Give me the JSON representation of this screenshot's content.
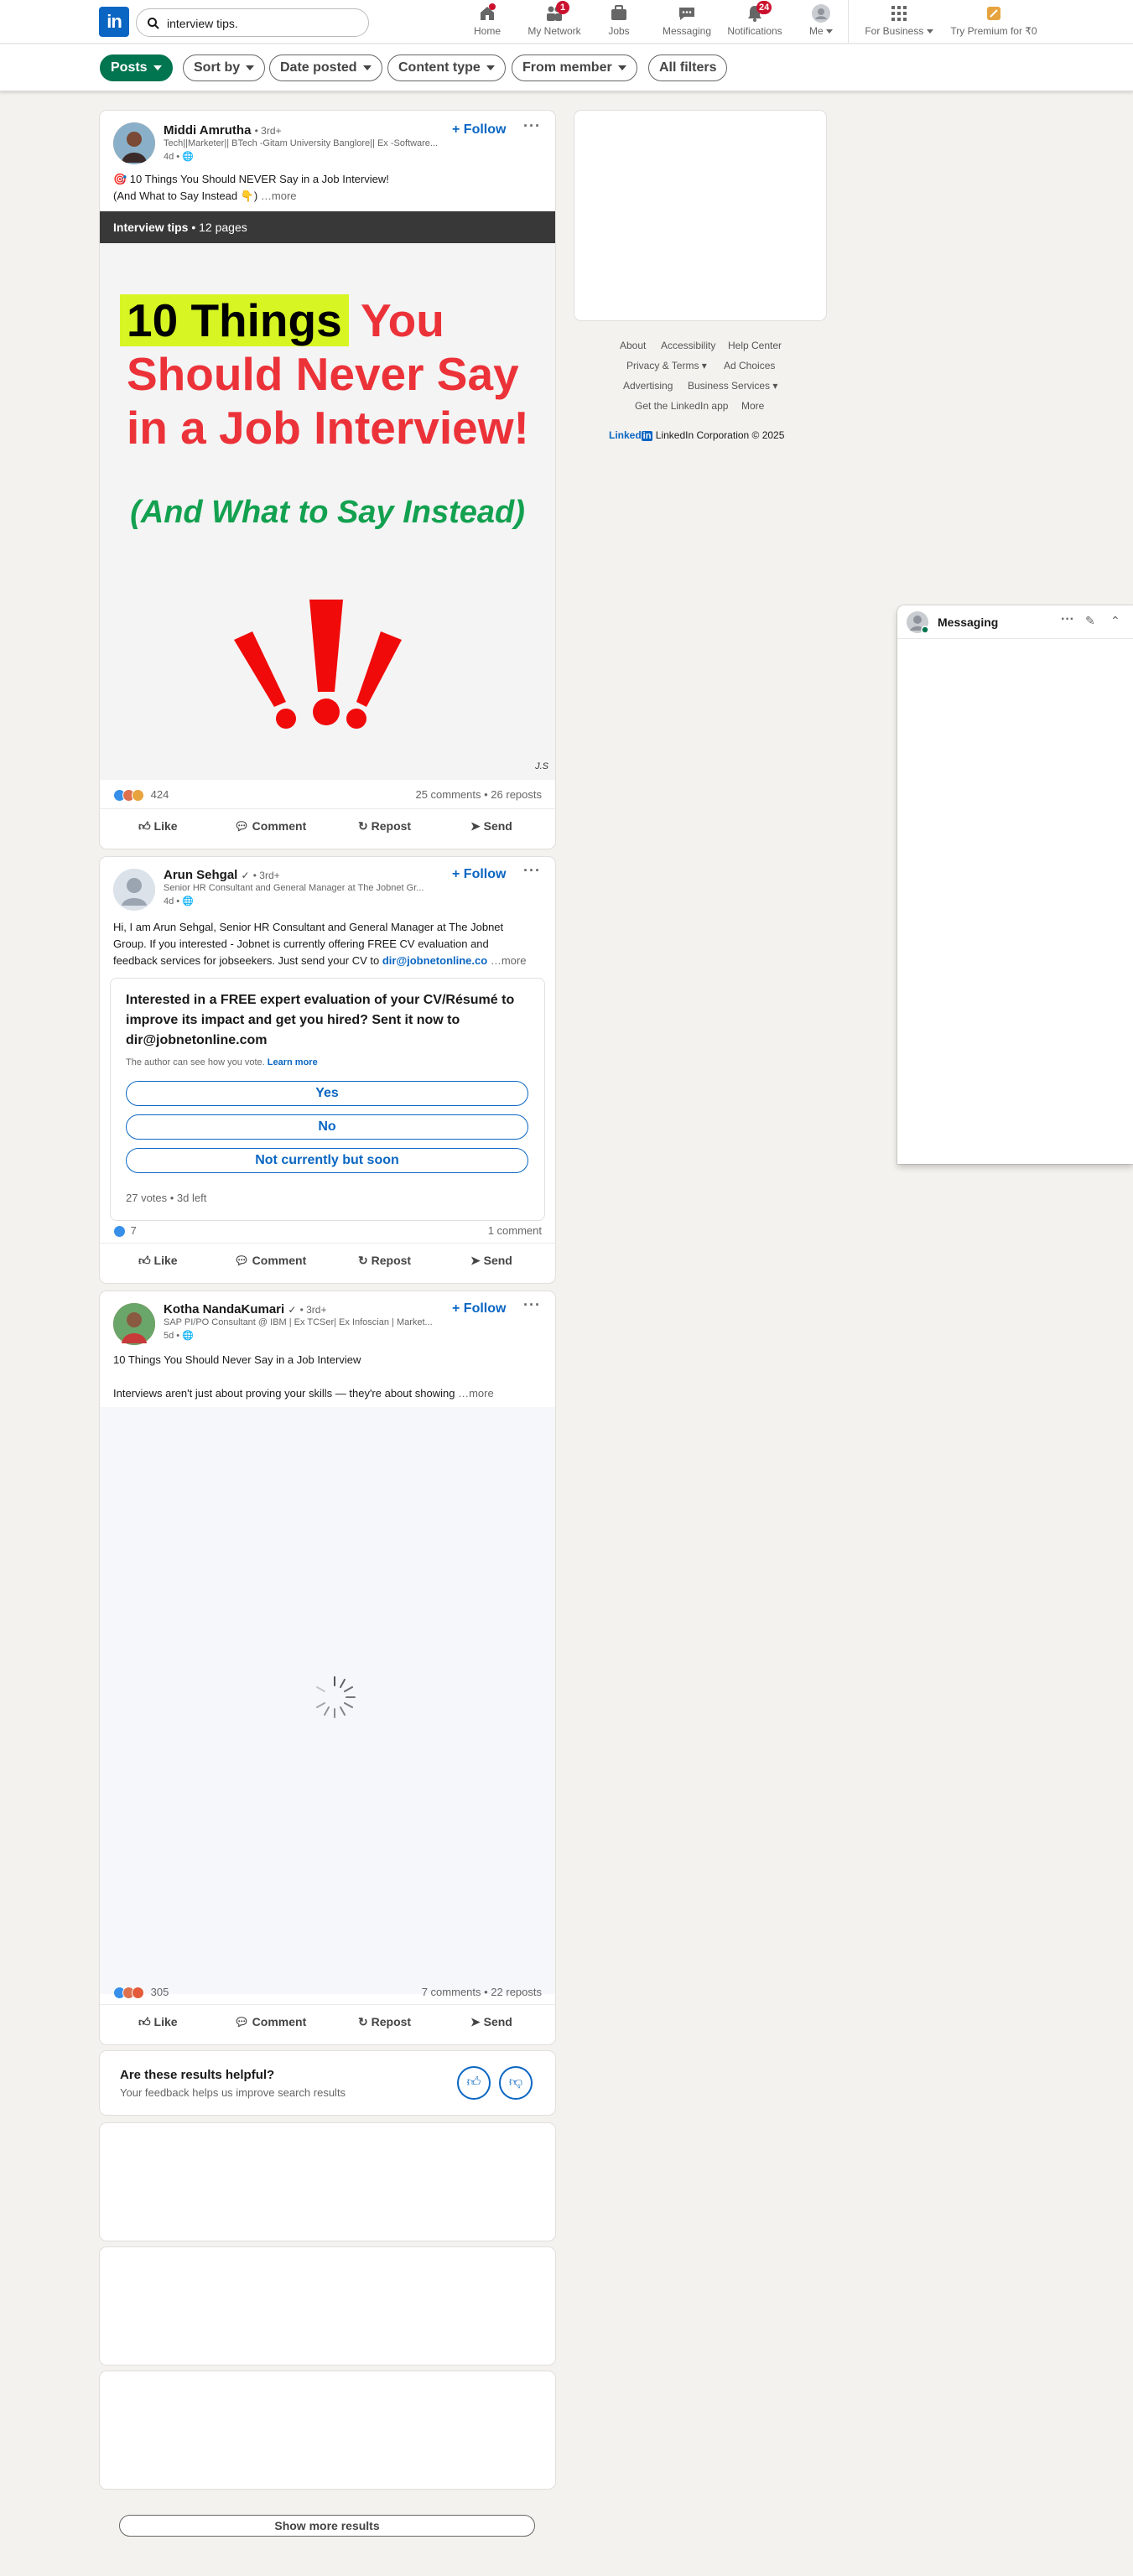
{
  "nav": {
    "logo_text": "in",
    "search_value": "interview tips.",
    "items": [
      {
        "label": "Home",
        "badge": "",
        "icon": "home-icon"
      },
      {
        "label": "My Network",
        "badge": "1",
        "icon": "network-icon"
      },
      {
        "label": "Jobs",
        "badge": "",
        "icon": "jobs-icon"
      },
      {
        "label": "Messaging",
        "badge": "",
        "icon": "messaging-icon"
      },
      {
        "label": "Notifications",
        "badge": "24",
        "icon": "bell-icon"
      },
      {
        "label": "Me",
        "badge": "",
        "icon": "avatar-icon"
      },
      {
        "label": "For Business",
        "badge": "",
        "icon": "grid-icon"
      },
      {
        "label": "Try Premium for ₹0",
        "badge": "",
        "icon": "premium-icon"
      }
    ]
  },
  "filters": {
    "posts": "Posts",
    "sort_by": "Sort by",
    "date_posted": "Date posted",
    "content_type": "Content type",
    "from_member": "From member",
    "all_filters": "All filters"
  },
  "posts": [
    {
      "author": "Middi Amrutha",
      "degree": "• 3rd+",
      "subtitle": "Tech||Marketer|| BTech -Gitam University Banglore|| Ex -Software...",
      "time": "4d •",
      "follow": "+ Follow",
      "text_line1": "🎯 10 Things You Should NEVER Say in a Job Interview!",
      "text_line2": "(And What to Say Instead 👇)",
      "more": "…more",
      "doc_title": "Interview tips",
      "doc_pages": " • 12 pages",
      "doc_heading_hl": "10 Things",
      "doc_heading_1": " You",
      "doc_heading_2": "Should Never Say",
      "doc_heading_3": "in a Job Interview!",
      "doc_sub": "(And What to Say Instead)",
      "doc_sig": "J.S",
      "reactions": "424",
      "stats": "25 comments • 26 reposts"
    },
    {
      "author": "Arun Sehgal",
      "degree": "• 3rd+",
      "subtitle": "Senior HR Consultant and General Manager at The Jobnet Gr...",
      "time": "4d •",
      "follow": "+ Follow",
      "text_line1": "Hi, I am Arun Sehgal, Senior HR Consultant and General Manager at The Jobnet",
      "text_line2": "Group. If you interested - Jobnet is currently offering FREE CV evaluation and",
      "text_line3": "feedback services for jobseekers. Just send your CV to",
      "email": "dir@jobnetonline.co",
      "more": "…more",
      "poll_question": "Interested in a FREE expert evaluation of your CV/Résumé to improve its impact and get you hired? Sent it now to dir@jobnetonline.com",
      "poll_note": "The author can see how you vote.",
      "poll_learn": "Learn more",
      "poll_options": [
        "Yes",
        "No",
        "Not currently but soon"
      ],
      "poll_meta": "27 votes • 3d left",
      "reactions": "7",
      "stats": "1 comment"
    },
    {
      "author": "Kotha NandaKumari",
      "degree": "• 3rd+",
      "subtitle": "SAP PI/PO Consultant @ IBM | Ex TCSer| Ex Infoscian | Market...",
      "time": "5d •",
      "follow": "+ Follow",
      "text_line1": "10 Things You Should Never Say in a Job Interview",
      "text_line2": "Interviews aren't just about proving your skills — they're about showing",
      "more": "…more",
      "reactions": "305",
      "stats": "7 comments • 22 reposts"
    }
  ],
  "actions": {
    "like": "Like",
    "comment": "Comment",
    "repost": "Repost",
    "send": "Send"
  },
  "feedback": {
    "title": "Are these results helpful?",
    "subtitle": "Your feedback helps us improve search results"
  },
  "footer": {
    "links_row1": [
      "About",
      "Accessibility",
      "Help Center"
    ],
    "privacy": "Privacy & Terms",
    "ad_choices": "Ad Choices",
    "advertising": "Advertising",
    "business": "Business Services",
    "app": "Get the LinkedIn app",
    "more": "More",
    "brand": "Linked",
    "brand_in": "in",
    "copyright": "LinkedIn Corporation © 2025"
  },
  "messaging": {
    "title": "Messaging"
  },
  "show_more": "Show more results",
  "colors": {
    "brand": "#0a66c2",
    "green": "#01754f",
    "red_text": "#ec3239",
    "green_text": "#13a150",
    "highlight": "#d6f522"
  }
}
